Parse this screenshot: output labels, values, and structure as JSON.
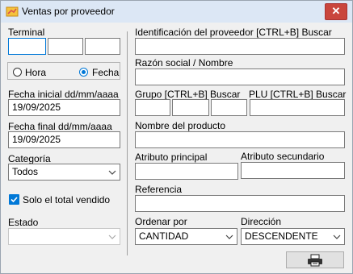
{
  "window": {
    "title": "Ventas por proveedor",
    "close_symbol": "✕"
  },
  "left": {
    "terminal_label": "Terminal",
    "radio_hora": "Hora",
    "radio_fecha": "Fecha",
    "fecha_inicial_label": "Fecha inicial dd/mm/aaaa",
    "fecha_inicial_value": "19/09/2025",
    "fecha_final_label": "Fecha final dd/mm/aaaa",
    "fecha_final_value": "19/09/2025",
    "categoria_label": "Categoría",
    "categoria_value": "Todos",
    "solo_total_label": "Solo el total vendido",
    "estado_label": "Estado",
    "estado_value": ""
  },
  "right": {
    "id_proveedor_label": "Identificación del proveedor [CTRL+B] Buscar",
    "razon_social_label": "Razón social / Nombre",
    "grupo_label": "Grupo [CTRL+B] Buscar",
    "plu_label": "PLU [CTRL+B] Buscar",
    "nombre_producto_label": "Nombre del producto",
    "atributo_principal_label": "Atributo principal",
    "atributo_secundario_label": "Atributo secundario",
    "referencia_label": "Referencia",
    "ordenar_por_label": "Ordenar por",
    "ordenar_por_value": "CANTIDAD",
    "direccion_label": "Dirección",
    "direccion_value": "DESCENDENTE"
  },
  "icons": {
    "app": "app-icon",
    "close": "close-icon",
    "print": "printer-icon",
    "dropdown": "chevron-down-icon",
    "check": "check-icon"
  },
  "colors": {
    "accent": "#0078d7",
    "close_bg": "#c9463d",
    "titlebar_bg": "#dce7f5"
  }
}
